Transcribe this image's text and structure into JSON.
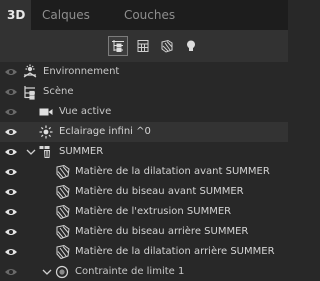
{
  "tabs": [
    {
      "label": "3D",
      "active": true
    },
    {
      "label": "Calques",
      "active": false
    },
    {
      "label": "Couches",
      "active": false
    }
  ],
  "toolbar": {
    "buttons": [
      {
        "name": "filter-whole-scene-icon",
        "selected": true
      },
      {
        "name": "filter-meshes-icon",
        "selected": false
      },
      {
        "name": "filter-materials-icon",
        "selected": false
      },
      {
        "name": "filter-lights-icon",
        "selected": false
      }
    ]
  },
  "tree": [
    {
      "label": "Environnement",
      "icon": "environment-icon",
      "indent": 0,
      "chevron": false,
      "eye": "dim"
    },
    {
      "label": "Scène",
      "icon": "scene-icon",
      "indent": 0,
      "chevron": false,
      "eye": "dim"
    },
    {
      "label": "Vue active",
      "icon": "camera-icon",
      "indent": 1,
      "chevron": false,
      "eye": "dim"
    },
    {
      "label": "Eclairage infini ^0",
      "icon": "infinite-light-icon",
      "indent": 1,
      "chevron": false,
      "eye": "on",
      "highlight": true
    },
    {
      "label": "SUMMER",
      "icon": "mesh-icon",
      "indent": 1,
      "chevron": true,
      "eye": "on"
    },
    {
      "label": "Matière de la dilatation avant SUMMER",
      "icon": "material-icon",
      "indent": 2,
      "chevron": false,
      "eye": "on"
    },
    {
      "label": "Matière du biseau avant SUMMER",
      "icon": "material-icon",
      "indent": 2,
      "chevron": false,
      "eye": "on"
    },
    {
      "label": "Matière de l'extrusion SUMMER",
      "icon": "material-icon",
      "indent": 2,
      "chevron": false,
      "eye": "on"
    },
    {
      "label": "Matière du biseau arrière SUMMER",
      "icon": "material-icon",
      "indent": 2,
      "chevron": false,
      "eye": "on"
    },
    {
      "label": "Matière de la dilatation arrière SUMMER",
      "icon": "material-icon",
      "indent": 2,
      "chevron": false,
      "eye": "on"
    },
    {
      "label": "Contrainte de limite 1",
      "icon": "constraint-icon",
      "indent": 2,
      "chevron": true,
      "eye": "dim"
    }
  ]
}
